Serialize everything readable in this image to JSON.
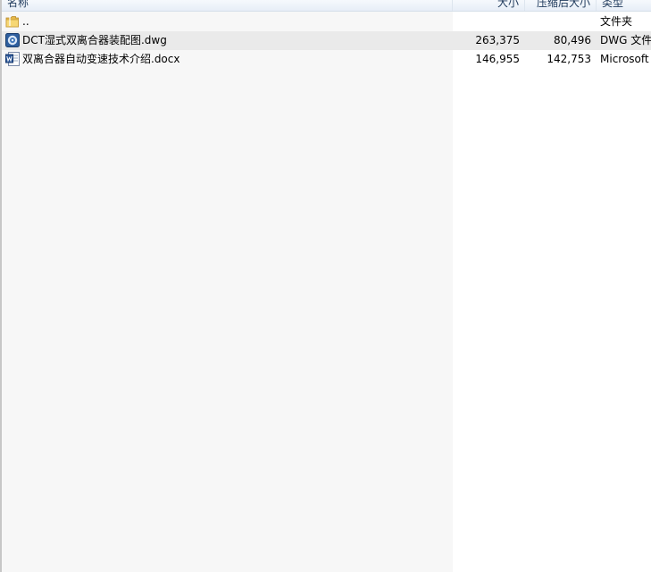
{
  "columns": {
    "name": "名称",
    "size": "大小",
    "packed": "压缩后大小",
    "type": "类型"
  },
  "rows": [
    {
      "name": "..",
      "size": "",
      "packed": "",
      "type": "文件夹",
      "icon": "folder-icon"
    },
    {
      "name": "DCT湿式双离合器装配图.dwg",
      "size": "263,375",
      "packed": "80,496",
      "type": "DWG 文件",
      "icon": "dwg-file-icon"
    },
    {
      "name": "双离合器自动变速技术介绍.docx",
      "size": "146,955",
      "packed": "142,753",
      "type": "Microsoft Word",
      "icon": "word-doc-icon"
    }
  ],
  "colors": {
    "header_text": "#1e395b",
    "selected_row": "#eaeaea",
    "name_column_bg": "#f7f7f7"
  }
}
